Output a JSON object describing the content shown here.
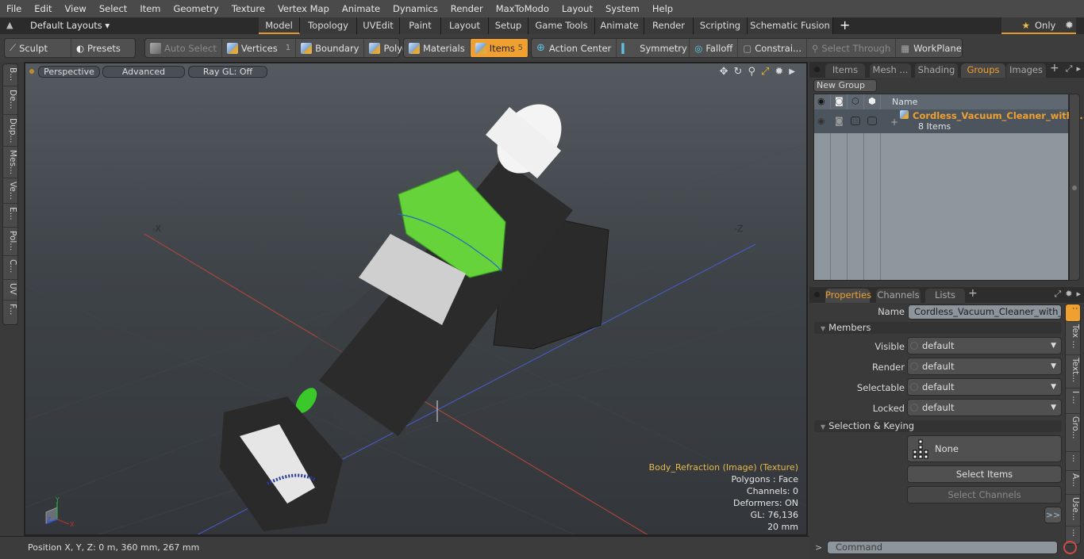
{
  "menu": [
    "File",
    "Edit",
    "View",
    "Select",
    "Item",
    "Geometry",
    "Texture",
    "Vertex Map",
    "Animate",
    "Dynamics",
    "Render",
    "MaxToModo",
    "Layout",
    "System",
    "Help"
  ],
  "layout_bar": {
    "selector": "Default Layouts",
    "tabs": [
      "Model",
      "Topology",
      "UVEdit",
      "Paint",
      "Layout",
      "Setup",
      "Game Tools",
      "Animate",
      "Render",
      "Scripting",
      "Schematic Fusion"
    ],
    "active_tab": "Model",
    "add_tab": "+",
    "only_label": "Only"
  },
  "toolbar": {
    "sculpt": "Sculpt",
    "presets": "Presets",
    "auto_select": "Auto Select",
    "vertices": "Vertices",
    "vertices_count": "1",
    "boundary": "Boundary",
    "polygons": "Polygons",
    "materials": "Materials",
    "items": "Items",
    "items_count": "5",
    "action_center": "Action Center",
    "symmetry": "Symmetry",
    "falloff": "Falloff",
    "constraints": "Constrai...",
    "select_through": "Select Through",
    "workplane": "WorkPlane"
  },
  "left_tabs": [
    "B...",
    "De...",
    "Dup...",
    "Mes...",
    "Ve...",
    "E...",
    "Pol...",
    "C...",
    "UV",
    "F..."
  ],
  "viewport": {
    "view_mode": "Perspective",
    "shading": "Advanced",
    "raygl": "Ray GL: Off",
    "axis_neg_x": "-X",
    "axis_neg_z": "-Z",
    "info": {
      "texture": "Body_Refraction (Image) (Texture)",
      "polygons": "Polygons : Face",
      "channels": "Channels: 0",
      "deformers": "Deformers: ON",
      "gl": "GL: 76,136",
      "scale": "20 mm"
    },
    "accent_color": "#e8b94a"
  },
  "status": {
    "position": "Position X, Y, Z:   0 m, 360 mm, 267 mm"
  },
  "groups_panel": {
    "tabs": [
      "Items",
      "Mesh ...",
      "Shading",
      "Groups",
      "Images"
    ],
    "active_tab": "Groups",
    "new_group": "New Group",
    "column_name": "Name",
    "rows": [
      {
        "name": "Cordless_Vacuum_Cleaner_with ...",
        "sub": "8 Items"
      }
    ]
  },
  "properties_panel": {
    "tabs": [
      "Properties",
      "Channels",
      "Lists"
    ],
    "active_tab": "Properties",
    "name_label": "Name",
    "name_value": "Cordless_Vacuum_Cleaner_with_Screw",
    "members_section": "Members",
    "fields": [
      {
        "label": "Visible",
        "value": "default"
      },
      {
        "label": "Render",
        "value": "default"
      },
      {
        "label": "Selectable",
        "value": "default"
      },
      {
        "label": "Locked",
        "value": "default"
      }
    ],
    "selection_section": "Selection & Keying",
    "none_label": "None",
    "select_items": "Select Items",
    "select_channels": "Select Channels",
    "more": ">>",
    "right_tabs": [
      ":",
      "Tex ...",
      "Text...",
      "I ...",
      "Gro...",
      "...",
      "A...",
      "Use...",
      "..."
    ]
  },
  "command": {
    "prompt": ">",
    "placeholder": "Command"
  }
}
